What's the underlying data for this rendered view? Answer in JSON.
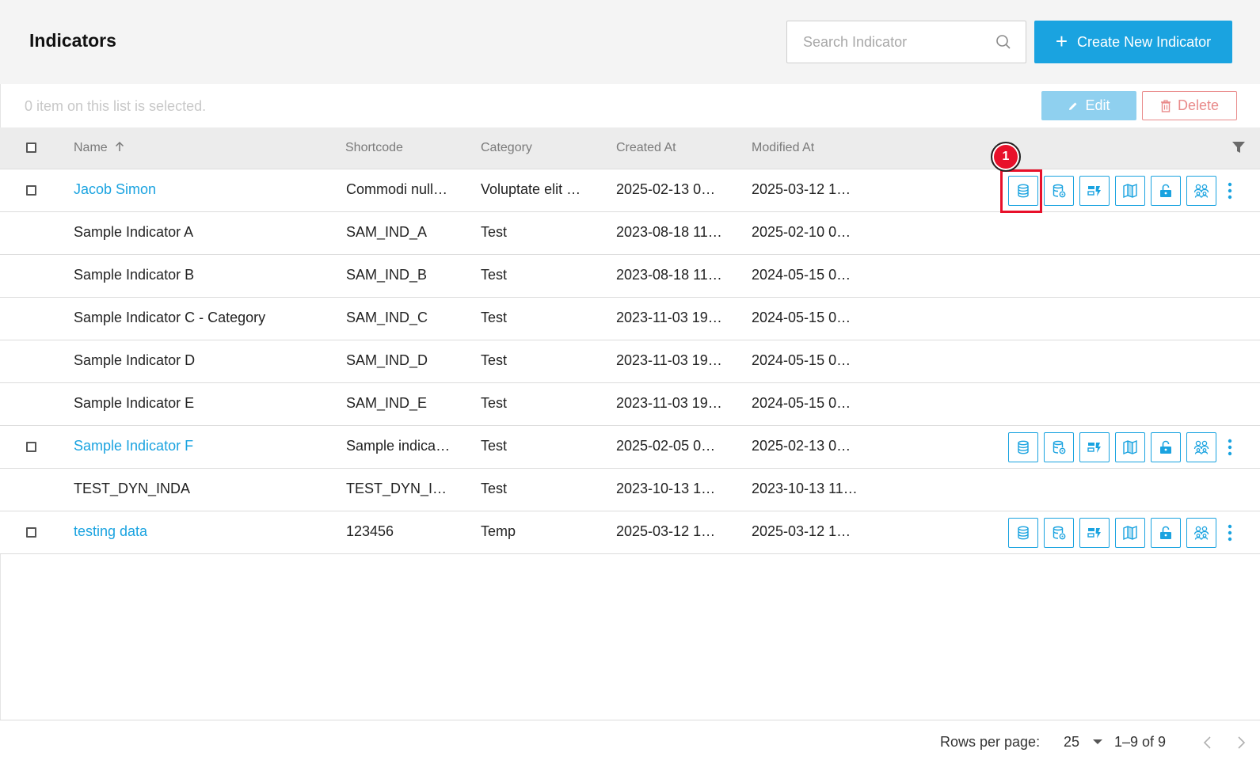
{
  "header": {
    "title": "Indicators",
    "search_placeholder": "Search Indicator",
    "create_label": "Create New Indicator"
  },
  "selection": {
    "text": "0 item on this list is selected.",
    "edit_label": "Edit",
    "delete_label": "Delete"
  },
  "columns": {
    "name": "Name",
    "shortcode": "Shortcode",
    "category": "Category",
    "created": "Created At",
    "modified": "Modified At"
  },
  "rows": [
    {
      "name": "Jacob Simon",
      "shortcode": "Commodi null…",
      "category": "Voluptate elit …",
      "created": "2025-02-13 0…",
      "modified": "2025-03-12 1…"
    },
    {
      "name": "Sample Indicator A",
      "shortcode": "SAM_IND_A",
      "category": "Test",
      "created": "2023-08-18 11…",
      "modified": "2025-02-10 0…"
    },
    {
      "name": "Sample Indicator B",
      "shortcode": "SAM_IND_B",
      "category": "Test",
      "created": "2023-08-18 11…",
      "modified": "2024-05-15 0…"
    },
    {
      "name": "Sample Indicator C - Category",
      "shortcode": "SAM_IND_C",
      "category": "Test",
      "created": "2023-11-03 19…",
      "modified": "2024-05-15 0…"
    },
    {
      "name": "Sample Indicator D",
      "shortcode": "SAM_IND_D",
      "category": "Test",
      "created": "2023-11-03 19…",
      "modified": "2024-05-15 0…"
    },
    {
      "name": "Sample Indicator E",
      "shortcode": "SAM_IND_E",
      "category": "Test",
      "created": "2023-11-03 19…",
      "modified": "2024-05-15 0…"
    },
    {
      "name": "Sample Indicator F",
      "shortcode": "Sample indica…",
      "category": "Test",
      "created": "2025-02-05 0…",
      "modified": "2025-02-13 0…"
    },
    {
      "name": "TEST_DYN_INDA",
      "shortcode": "TEST_DYN_I…",
      "category": "Test",
      "created": "2023-10-13 1…",
      "modified": "2023-10-13 11…"
    },
    {
      "name": "testing data",
      "shortcode": "123456",
      "category": "Temp",
      "created": "2025-03-12 1…",
      "modified": "2025-03-12 1…"
    }
  ],
  "annotation": {
    "badge": "1"
  },
  "footer": {
    "rows_per_page_label": "Rows per page:",
    "rows_per_page_value": "25",
    "range": "1–9 of 9"
  },
  "colors": {
    "accent": "#1aa3e0",
    "highlight": "#e8102a",
    "delete": "#e98a8a"
  }
}
